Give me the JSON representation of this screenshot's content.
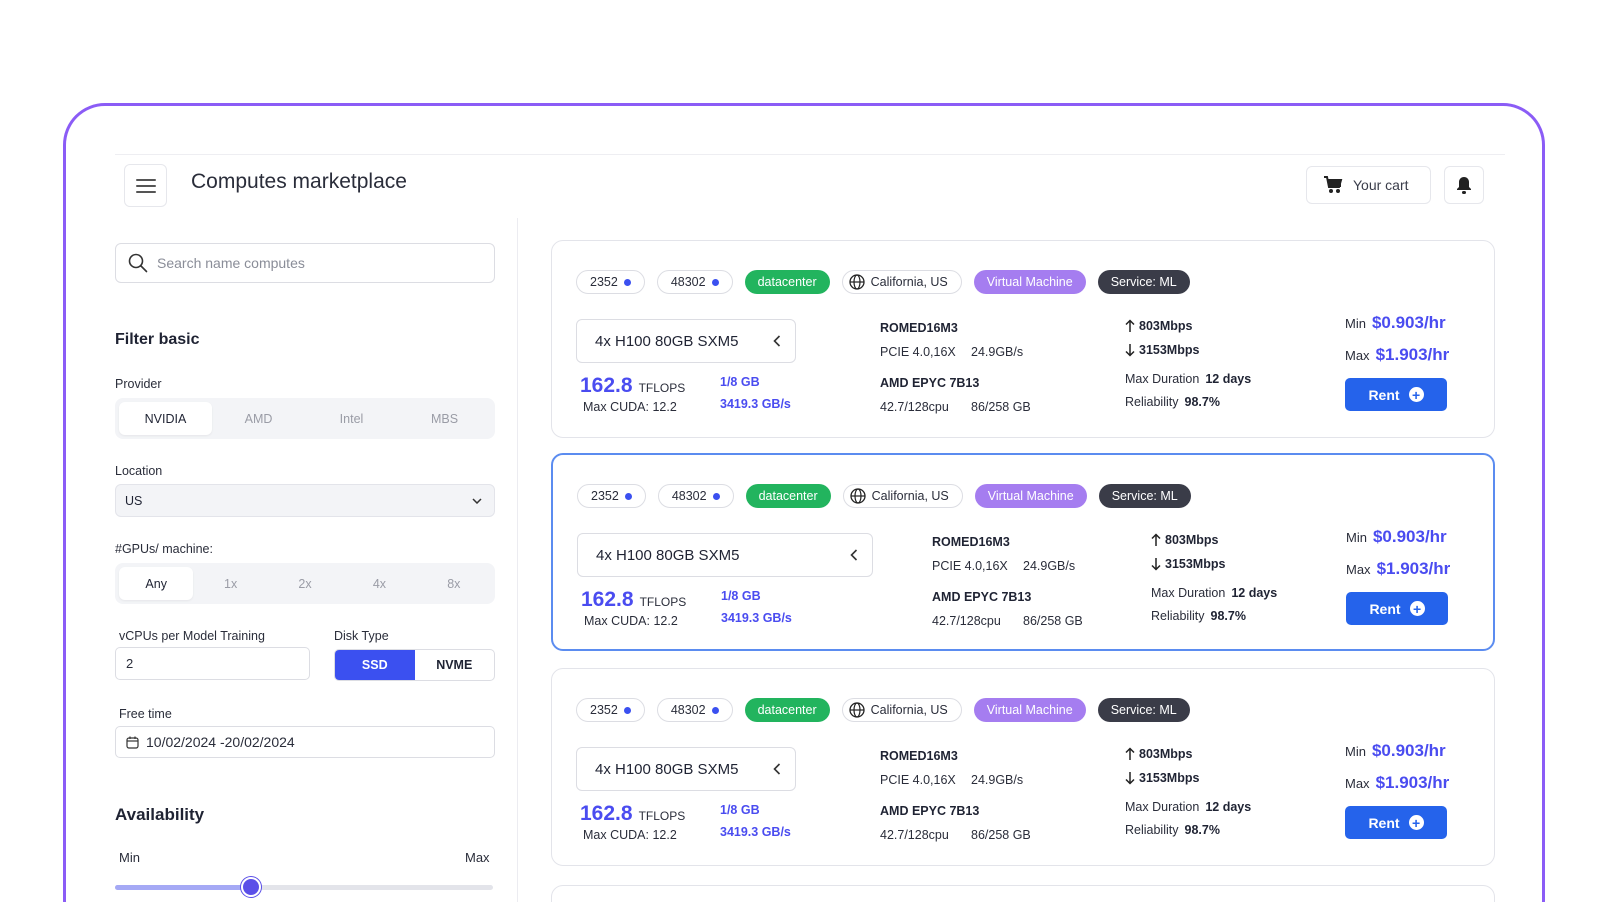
{
  "header": {
    "title": "Computes marketplace",
    "cart_label": "Your cart"
  },
  "sidebar": {
    "search_placeholder": "Search name computes",
    "filter_title": "Filter basic",
    "provider": {
      "label": "Provider",
      "options": [
        "NVIDIA",
        "AMD",
        "Intel",
        "MBS"
      ],
      "selected": "NVIDIA"
    },
    "location": {
      "label": "Location",
      "value": "US"
    },
    "gpus": {
      "label": "#GPUs/ machine:",
      "options": [
        "Any",
        "1x",
        "2x",
        "4x",
        "8x"
      ],
      "selected": "Any"
    },
    "vcpus": {
      "label": "vCPUs per Model Training",
      "value": "2"
    },
    "disk": {
      "label": "Disk Type",
      "options": [
        "SSD",
        "NVME"
      ],
      "selected": "SSD"
    },
    "free_time": {
      "label": "Free time",
      "value": "10/02/2024 -20/02/2024"
    },
    "availability": {
      "title": "Availability",
      "min_label": "Min",
      "max_label": "Max",
      "level": 0.36
    }
  },
  "cards": [
    {
      "id1": "2352",
      "id2": "48302",
      "type": "datacenter",
      "location": "California, US",
      "vm": "Virtual Machine",
      "service": "Service: ML",
      "gpu": "4x H100 80GB SXM5",
      "tflops": "162.8",
      "tflops_unit": "TFLOPS",
      "cuda": "Max CUDA: 12.2",
      "mem": "1/8 GB",
      "bandwidth": "3419.3 GB/s",
      "board": "ROMED16M3",
      "pcie": "PCIE 4.0,16X",
      "pcie_speed": "24.9GB/s",
      "cpu": "AMD EPYC 7B13",
      "cpu_usage": "42.7/128cpu",
      "storage": "86/258 GB",
      "upload": "803Mbps",
      "download": "3153Mbps",
      "duration_label": "Max Duration",
      "duration": "12 days",
      "reliability_label": "Reliability",
      "reliability": "98.7%",
      "min_label": "Min",
      "min_price": "$0.903/hr",
      "max_label": "Max",
      "max_price": "$1.903/hr",
      "rent": "Rent"
    },
    {
      "id1": "2352",
      "id2": "48302",
      "type": "datacenter",
      "location": "California, US",
      "vm": "Virtual Machine",
      "service": "Service: ML",
      "gpu": "4x H100 80GB SXM5",
      "tflops": "162.8",
      "tflops_unit": "TFLOPS",
      "cuda": "Max CUDA: 12.2",
      "mem": "1/8 GB",
      "bandwidth": "3419.3 GB/s",
      "board": "ROMED16M3",
      "pcie": "PCIE 4.0,16X",
      "pcie_speed": "24.9GB/s",
      "cpu": "AMD EPYC 7B13",
      "cpu_usage": "42.7/128cpu",
      "storage": "86/258 GB",
      "upload": "803Mbps",
      "download": "3153Mbps",
      "duration_label": "Max Duration",
      "duration": "12 days",
      "reliability_label": "Reliability",
      "reliability": "98.7%",
      "min_label": "Min",
      "min_price": "$0.903/hr",
      "max_label": "Max",
      "max_price": "$1.903/hr",
      "rent": "Rent"
    },
    {
      "id1": "2352",
      "id2": "48302",
      "type": "datacenter",
      "location": "California, US",
      "vm": "Virtual Machine",
      "service": "Service: ML",
      "gpu": "4x H100 80GB SXM5",
      "tflops": "162.8",
      "tflops_unit": "TFLOPS",
      "cuda": "Max CUDA: 12.2",
      "mem": "1/8 GB",
      "bandwidth": "3419.3 GB/s",
      "board": "ROMED16M3",
      "pcie": "PCIE 4.0,16X",
      "pcie_speed": "24.9GB/s",
      "cpu": "AMD EPYC 7B13",
      "cpu_usage": "42.7/128cpu",
      "storage": "86/258 GB",
      "upload": "803Mbps",
      "download": "3153Mbps",
      "duration_label": "Max Duration",
      "duration": "12 days",
      "reliability_label": "Reliability",
      "reliability": "98.7%",
      "min_label": "Min",
      "min_price": "$0.903/hr",
      "max_label": "Max",
      "max_price": "$1.903/hr",
      "rent": "Rent"
    }
  ],
  "icons": {
    "menu": "menu-icon",
    "cart": "cart-icon",
    "bell": "bell-icon",
    "search": "search-icon",
    "calendar": "calendar-icon",
    "globe": "globe-icon",
    "chevron": "chevron-left-icon"
  },
  "colors": {
    "accent": "#4a4cf0",
    "frame": "#8b5cf6",
    "green": "#22b45e",
    "purple": "#a57df0",
    "rent": "#2563eb"
  }
}
